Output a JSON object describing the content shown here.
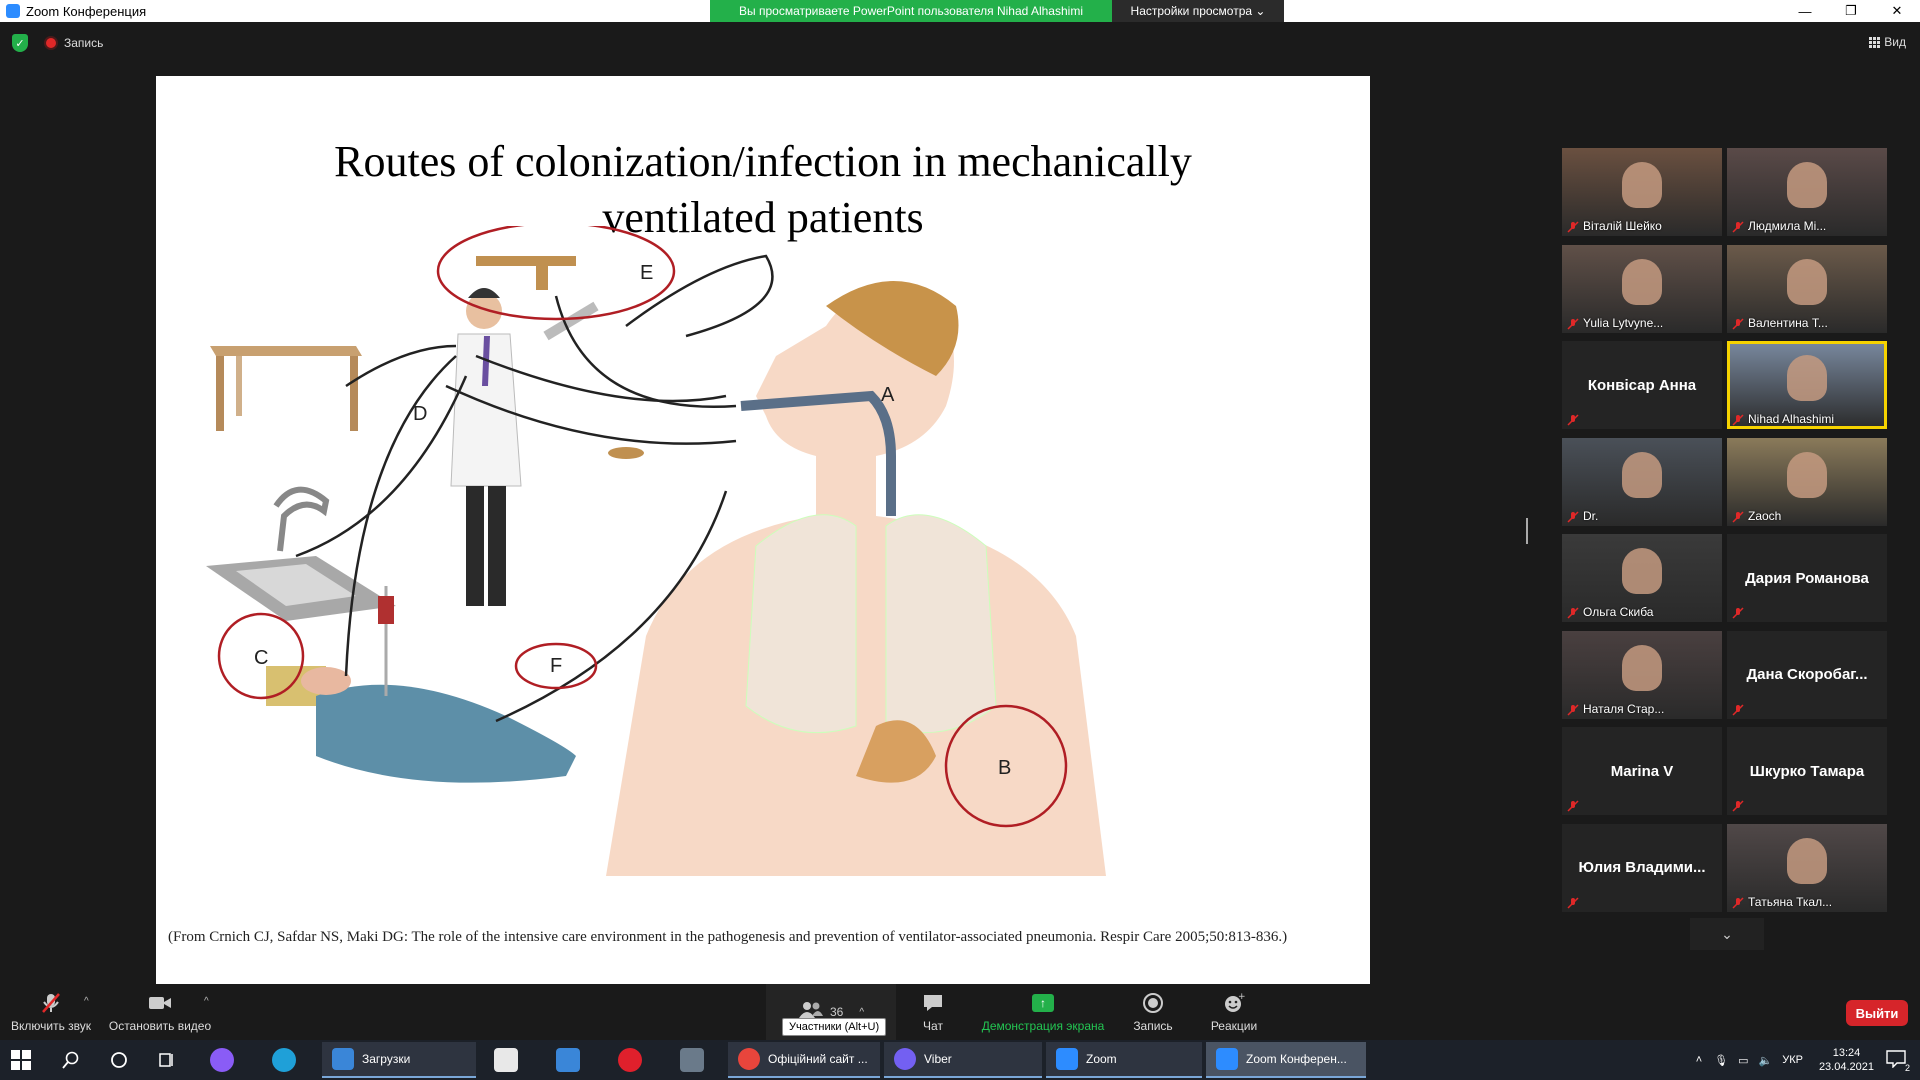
{
  "window": {
    "title": "Zoom Конференция",
    "share_notice": "Вы просматриваете PowerPoint пользователя Nihad Alhashimi",
    "view_options": "Настройки просмотра ⌄",
    "controls": [
      "—",
      "❐",
      "✕"
    ]
  },
  "meeting_bar": {
    "recording_label": "Запись",
    "view_label": "Вид"
  },
  "slide": {
    "title_line1": "Routes of colonization/infection in mechanically",
    "title_line2": "ventilated patients",
    "caption": "(From Crnich CJ, Safdar NS, Maki DG: The role of the intensive care environment  in the pathogenesis  and prevention of ventilator-associated pneumonia.  Respir Care 2005;50:813-836.)",
    "figure_labels": [
      "A",
      "B",
      "C",
      "D",
      "E",
      "F"
    ]
  },
  "gallery": {
    "participants": [
      {
        "name": "Віталій Шейко",
        "video": true,
        "active": false
      },
      {
        "name": "Людмила Мі...",
        "video": true,
        "active": false
      },
      {
        "name": "Yulia Lytvyne...",
        "video": true,
        "active": false
      },
      {
        "name": "Валентина Т...",
        "video": true,
        "active": false
      },
      {
        "name": "Конвісар Анна",
        "video": false,
        "active": false
      },
      {
        "name": "Nihad Alhashimi",
        "video": true,
        "active": true
      },
      {
        "name": "Dr.",
        "video": true,
        "active": false
      },
      {
        "name": "Zaoch",
        "video": true,
        "active": false
      },
      {
        "name": "Ольга Скиба",
        "video": true,
        "active": false
      },
      {
        "name": "Дария Романова",
        "video": false,
        "active": false
      },
      {
        "name": "Наталя Стар...",
        "video": true,
        "active": false
      },
      {
        "name": "Дана  Скоробаг...",
        "video": false,
        "active": false
      },
      {
        "name": "Marina V",
        "video": false,
        "active": false
      },
      {
        "name": "Шкурко Тамара",
        "video": false,
        "active": false
      },
      {
        "name": "Юлия  Владими...",
        "video": false,
        "active": false
      },
      {
        "name": "Татьяна Ткал...",
        "video": true,
        "active": false
      }
    ],
    "scroll_icon": "chevron-down-icon"
  },
  "toolbar": {
    "unmute": "Включить звук",
    "stop_video": "Остановить видео",
    "participants_count": "36",
    "participants_tooltip": "Участники (Alt+U)",
    "chat": "Чат",
    "share": "Демонстрация экрана",
    "record": "Запись",
    "reactions": "Реакции",
    "leave": "Выйти"
  },
  "taskbar": {
    "apps": [
      {
        "label": "Загрузки",
        "color": "#3a86d8"
      },
      {
        "label": "Офіційний сайт ...",
        "color": "#e8453c"
      },
      {
        "label": "Viber",
        "color": "#7360f2"
      },
      {
        "label": "Zoom",
        "color": "#2d8cff"
      },
      {
        "label": "Zoom Конферен...",
        "color": "#2d8cff"
      }
    ],
    "lang": "УКР",
    "time": "13:24",
    "date": "23.04.2021",
    "notifications": "2"
  },
  "colors": {
    "zoom_blue": "#2d8cff",
    "share_green": "#23b04a",
    "leave_red": "#d6252a",
    "active_speaker": "#f6d300"
  }
}
